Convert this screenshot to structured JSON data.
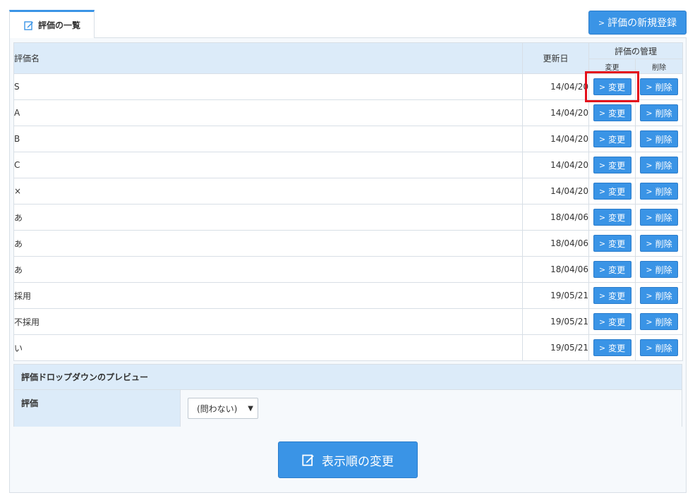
{
  "tab": {
    "label": "評価の一覧"
  },
  "new_button": {
    "label": "評価の新規登録"
  },
  "table": {
    "headers": {
      "name": "評価名",
      "date": "更新日",
      "manage": "評価の管理",
      "edit": "変更",
      "delete": "削除"
    },
    "rows": [
      {
        "name": "S",
        "date": "14/04/20"
      },
      {
        "name": "A",
        "date": "14/04/20"
      },
      {
        "name": "B",
        "date": "14/04/20"
      },
      {
        "name": "C",
        "date": "14/04/20"
      },
      {
        "name": "×",
        "date": "14/04/20"
      },
      {
        "name": "あ",
        "date": "18/04/06"
      },
      {
        "name": "あ",
        "date": "18/04/06"
      },
      {
        "name": "あ",
        "date": "18/04/06"
      },
      {
        "name": "採用",
        "date": "19/05/21"
      },
      {
        "name": "不採用",
        "date": "19/05/21"
      },
      {
        "name": "い",
        "date": "19/05/21"
      }
    ],
    "edit_label": "変更",
    "delete_label": "削除"
  },
  "preview": {
    "title": "評価ドロップダウンのプレビュー",
    "field_label": "評価",
    "select_value": "(問わない)"
  },
  "order_button": {
    "label": "表示順の変更"
  },
  "colors": {
    "accent": "#3a94e6",
    "header_bg": "#dcebf9",
    "highlight": "#e4101c"
  }
}
